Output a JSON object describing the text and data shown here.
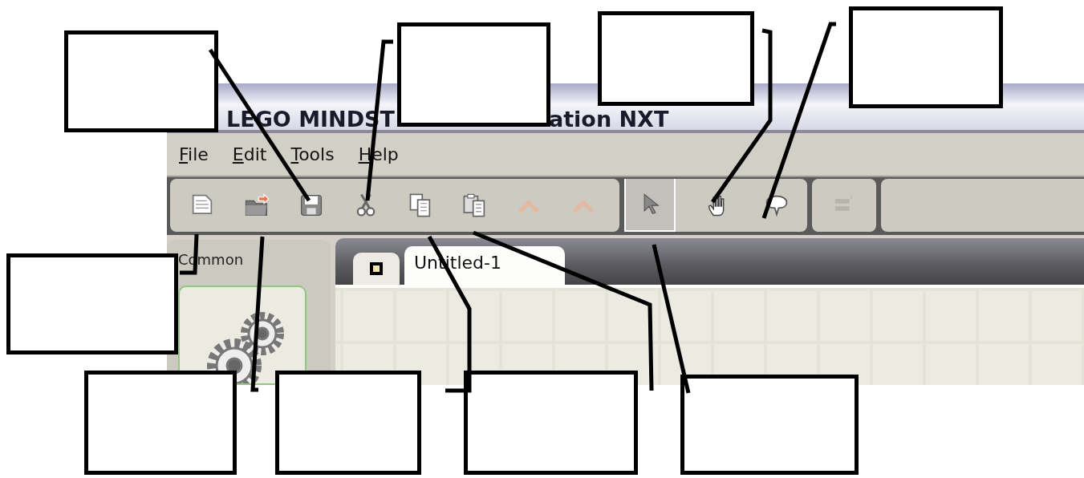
{
  "window": {
    "title_parts": [
      "LEGO MINDST",
      "ation NXT"
    ]
  },
  "menu": [
    {
      "label": "File"
    },
    {
      "label": "Edit"
    },
    {
      "label": "Tools"
    },
    {
      "label": "Help"
    }
  ],
  "toolbar": [
    {
      "group": [
        {
          "kind": "new",
          "disabled": false,
          "selected": false
        },
        {
          "kind": "open",
          "disabled": false,
          "selected": false
        },
        {
          "kind": "save",
          "disabled": false,
          "selected": false
        },
        {
          "kind": "cut",
          "disabled": false,
          "selected": false
        },
        {
          "kind": "copy",
          "disabled": false,
          "selected": false
        },
        {
          "kind": "paste",
          "disabled": false,
          "selected": false
        },
        {
          "kind": "undo",
          "disabled": true,
          "selected": false
        },
        {
          "kind": "redo",
          "disabled": true,
          "selected": false
        }
      ]
    },
    {
      "group": [
        {
          "kind": "pointer",
          "disabled": false,
          "selected": true
        },
        {
          "kind": "pan",
          "disabled": false,
          "selected": false
        },
        {
          "kind": "comment",
          "disabled": false,
          "selected": false
        }
      ]
    },
    {
      "group": [
        {
          "kind": "configure",
          "disabled": true,
          "selected": false
        }
      ]
    }
  ],
  "palette": {
    "label": "Common"
  },
  "tabs": [
    {
      "label": "Untitled-1",
      "selected": true
    }
  ]
}
